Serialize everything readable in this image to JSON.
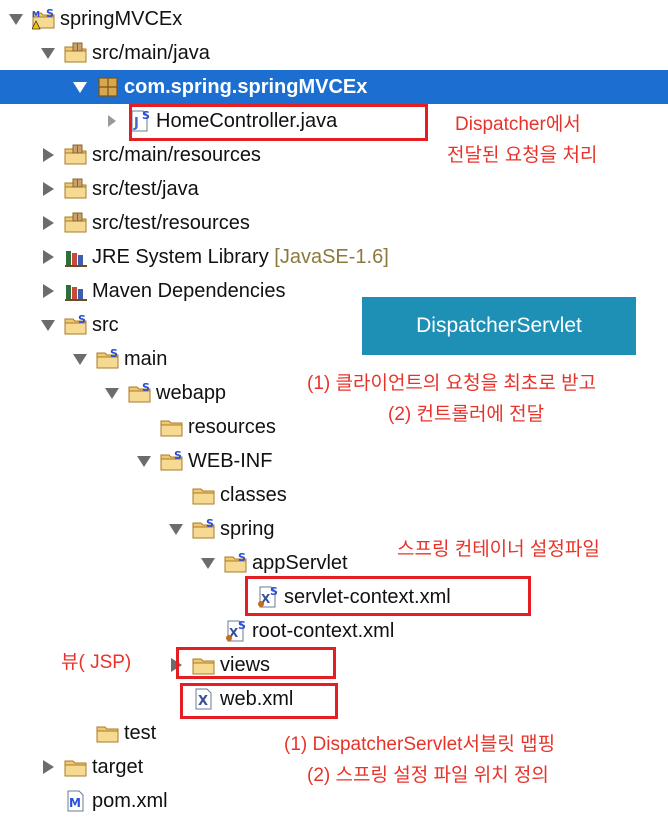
{
  "tree": [
    {
      "label": "springMVCEx",
      "toggle": "expanded",
      "icon": "maven-project-icon"
    },
    {
      "label": "src/main/java",
      "toggle": "expanded",
      "icon": "source-folder-icon"
    },
    {
      "label": "com.spring.springMVCEx",
      "toggle": "expanded",
      "icon": "package-icon",
      "selected": true
    },
    {
      "label": "HomeController.java",
      "toggle": "collapsed",
      "icon": "java-file-icon"
    },
    {
      "label": "src/main/resources",
      "toggle": "collapsed",
      "icon": "source-folder-icon"
    },
    {
      "label": "src/test/java",
      "toggle": "collapsed",
      "icon": "source-folder-icon"
    },
    {
      "label": "src/test/resources",
      "toggle": "collapsed",
      "icon": "source-folder-icon"
    },
    {
      "label": "JRE System Library",
      "suffix": "[JavaSE-1.6]",
      "toggle": "collapsed",
      "icon": "library-icon"
    },
    {
      "label": "Maven Dependencies",
      "toggle": "collapsed",
      "icon": "library-icon"
    },
    {
      "label": "src",
      "toggle": "expanded",
      "icon": "spring-folder-icon"
    },
    {
      "label": "main",
      "toggle": "expanded",
      "icon": "spring-folder-icon"
    },
    {
      "label": "webapp",
      "toggle": "expanded",
      "icon": "spring-folder-icon"
    },
    {
      "label": "resources",
      "toggle": "none",
      "icon": "folder-icon"
    },
    {
      "label": "WEB-INF",
      "toggle": "expanded",
      "icon": "spring-folder-icon"
    },
    {
      "label": "classes",
      "toggle": "none",
      "icon": "folder-icon"
    },
    {
      "label": "spring",
      "toggle": "expanded",
      "icon": "spring-folder-icon"
    },
    {
      "label": "appServlet",
      "toggle": "expanded",
      "icon": "spring-folder-icon"
    },
    {
      "label": "servlet-context.xml",
      "toggle": "none",
      "icon": "spring-xml-icon"
    },
    {
      "label": "root-context.xml",
      "toggle": "none",
      "icon": "spring-xml-icon"
    },
    {
      "label": "views",
      "toggle": "collapsed",
      "icon": "folder-icon"
    },
    {
      "label": "web.xml",
      "toggle": "none",
      "icon": "xml-file-icon"
    },
    {
      "label": "test",
      "toggle": "none",
      "icon": "folder-icon"
    },
    {
      "label": "target",
      "toggle": "collapsed",
      "icon": "folder-icon"
    },
    {
      "label": "pom.xml",
      "toggle": "none",
      "icon": "pom-file-icon"
    }
  ],
  "annotations": {
    "dispatcher_note_1": "Dispatcher에서",
    "dispatcher_note_2": "전달된 요청을 처리",
    "dispatcher_servlet_label": "DispatcherServlet",
    "servlet_note_1": "(1) 클라이언트의 요청을 최초로 받고",
    "servlet_note_2": "(2) 컨트롤러에 전달",
    "container_note": "스프링 컨테이너 설정파일",
    "views_note": "뷰( JSP)",
    "webxml_note_1": "(1) DispatcherServlet서블릿 맵핑",
    "webxml_note_2": "(2) 스프링 설정 파일 위치 정의"
  },
  "colors": {
    "selection": "#1c6fd1",
    "annotation_red": "#e51e24",
    "button_blue": "#1e90b5",
    "folder_fill": "#f6d384",
    "spring_s": "#2a4fd6"
  }
}
